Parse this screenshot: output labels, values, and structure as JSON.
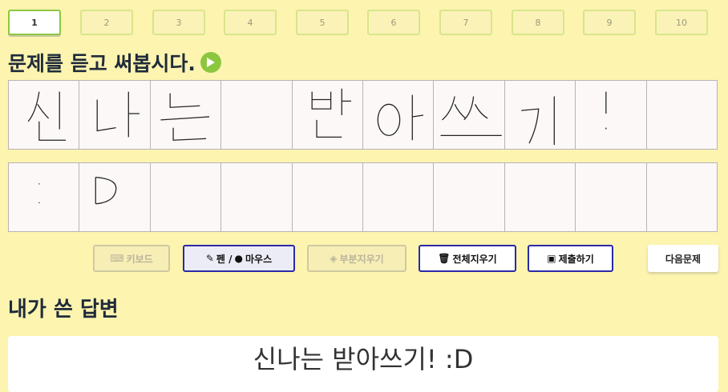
{
  "tabs": [
    "1",
    "2",
    "3",
    "4",
    "5",
    "6",
    "7",
    "8",
    "9",
    "10"
  ],
  "active_tab": "1",
  "title": "문제를 듣고 써봅시다.",
  "rows": [
    [
      "신",
      "나",
      "는",
      "",
      "받",
      "아",
      "쓰",
      "기",
      "!",
      ""
    ],
    [
      ":",
      "D",
      "",
      "",
      "",
      "",
      "",
      "",
      "",
      ""
    ]
  ],
  "buttons": {
    "keyboard": "키보드",
    "pen_mouse": "펜 / ",
    "pen_mouse_suffix": "마우스",
    "partial_erase": "부분지우기",
    "erase_all": "전체지우기",
    "submit": "제출하기",
    "next": "다음문제"
  },
  "subtitle": "내가 쓴 답변",
  "answer": "신나는 받아쓰기! :D",
  "colors": {
    "background": "#fdf4b0",
    "accent": "#8cc63f",
    "button_border": "#2a2aa8"
  }
}
